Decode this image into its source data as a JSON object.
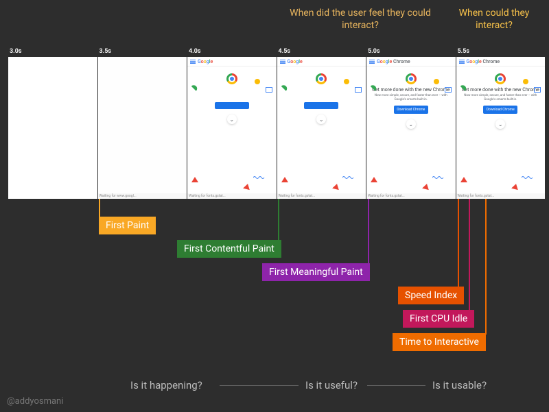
{
  "questions": {
    "q1": "When did the user feel they could interact?",
    "q2": "When could they interact?"
  },
  "frames": [
    {
      "time": "3.0s",
      "state": "blank"
    },
    {
      "time": "3.5s",
      "state": "loading",
      "status": "Waiting for www.googl..."
    },
    {
      "time": "4.0s",
      "state": "partial",
      "logo": "Google",
      "status": "Waiting for fonts.gstat..."
    },
    {
      "time": "4.5s",
      "state": "partial",
      "logo": "Google",
      "status": "Waiting for fonts.gstat..."
    },
    {
      "time": "5.0s",
      "state": "full",
      "logo": "Google Chrome",
      "heading": "Get more done with the new Chrome",
      "sub": "Now more simple, secure, and faster than ever – with Google's smarts built-in.",
      "button": "Download Chrome",
      "status": "Waiting for fonts.gstat..."
    },
    {
      "time": "5.5s",
      "state": "full",
      "logo": "Google Chrome",
      "heading": "Get more done with the new Chrome",
      "sub": "Now more simple, secure, and faster than ever – with Google's smarts built-in.",
      "button": "Download Chrome",
      "status": "Waiting for fonts.gstat..."
    }
  ],
  "metrics": {
    "fp": "First Paint",
    "fcp": "First Contentful Paint",
    "fmp": "First Meaningful Paint",
    "si": "Speed Index",
    "fci": "First CPU Idle",
    "tti": "Time to Interactive"
  },
  "bottom_questions": {
    "q1": "Is it happening?",
    "q2": "Is it useful?",
    "q3": "Is it usable?"
  },
  "credit": "@addyosmani"
}
